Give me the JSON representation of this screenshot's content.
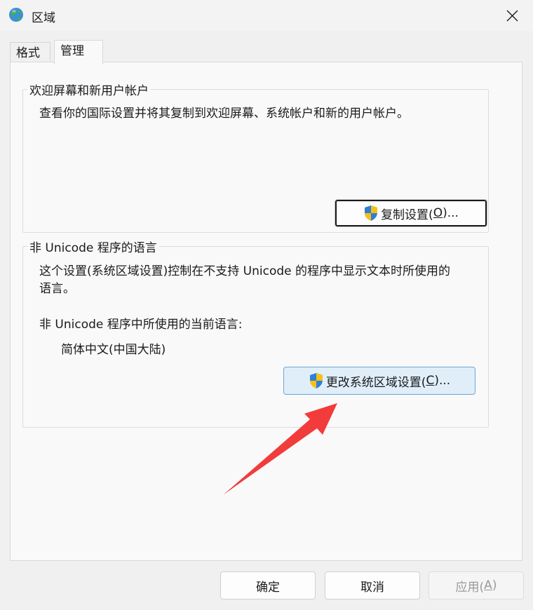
{
  "window": {
    "title": "区域",
    "app_icon": "globe-icon",
    "close_icon": "close-icon"
  },
  "tabs": [
    {
      "label": "格式",
      "active": false
    },
    {
      "label": "管理",
      "active": true
    }
  ],
  "welcome_group": {
    "title": "欢迎屏幕和新用户帐户",
    "description": "查看你的国际设置并将其复制到欢迎屏幕、系统帐户和新的用户帐户。",
    "button_label": "复制设置(",
    "button_mnemonic": "O",
    "button_suffix": ")..."
  },
  "unicode_group": {
    "title": "非 Unicode 程序的语言",
    "description_line1": "这个设置(系统区域设置)控制在不支持 Unicode 的程序中显示文本时所使用的",
    "description_line2": "语言。",
    "current_label": "非 Unicode 程序中所使用的当前语言:",
    "current_value": "简体中文(中国大陆)",
    "button_label": "更改系统区域设置(",
    "button_mnemonic": "C",
    "button_suffix": ")..."
  },
  "footer": {
    "ok_label": "确定",
    "cancel_label": "取消",
    "apply_label": "应用(",
    "apply_mnemonic": "A",
    "apply_suffix": ")",
    "apply_enabled": false
  },
  "colors": {
    "arrow": "#f23b3b",
    "accent_button_bg": "#e0eef9",
    "accent_button_border": "#6aa6d6"
  }
}
